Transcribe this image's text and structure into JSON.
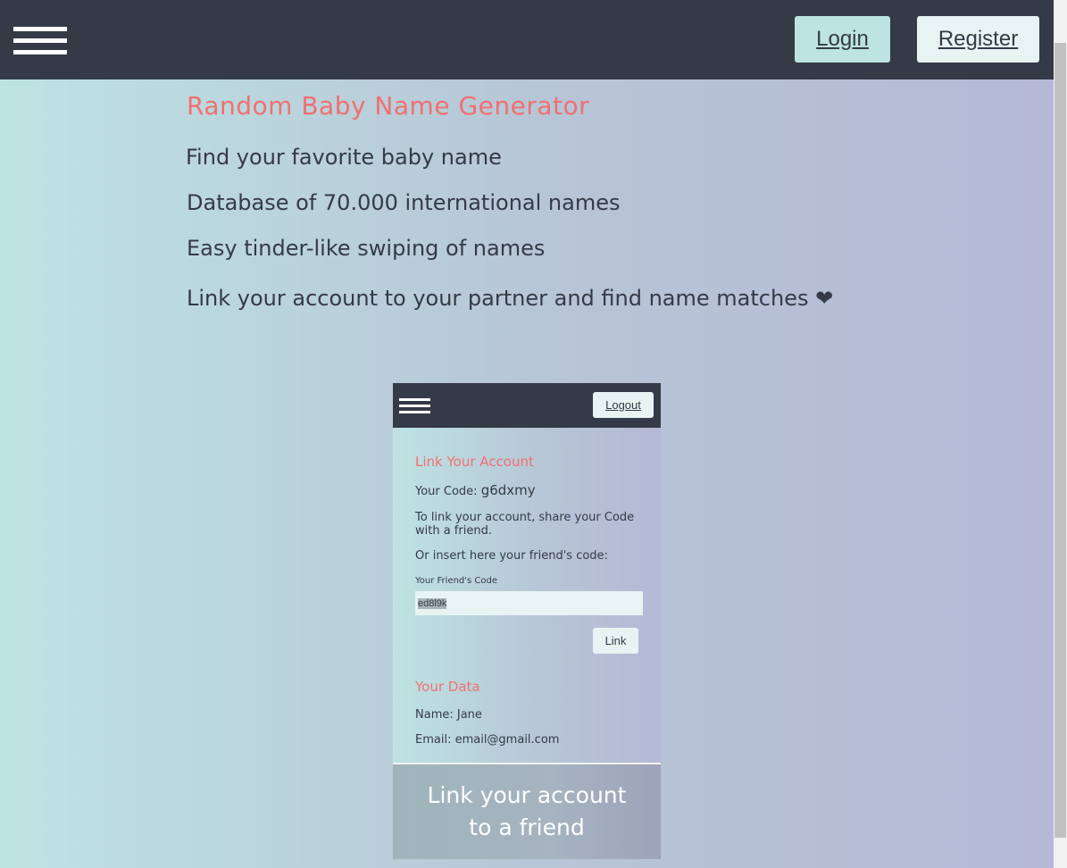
{
  "header": {
    "login_label": "Login",
    "register_label": "Register"
  },
  "main": {
    "title": "Random Baby Name Generator",
    "features": [
      "Find your favorite baby name",
      "Database of 70.000 international names",
      "Easy tinder-like swiping of names",
      "Link your account to your partner and find name matches"
    ],
    "heart": "❤"
  },
  "phone": {
    "logout_label": "Logout",
    "link_heading": "Link Your Account",
    "code_label": "Your Code: ",
    "code_value": "g6dxmy",
    "share_text": "To link your account, share your Code with a friend.",
    "insert_text": "Or insert here your friend's code:",
    "friend_code_label": "Your Friend's Code",
    "friend_code_value": "ed8l9k",
    "link_button": "Link",
    "data_heading": "Your Data",
    "name_line": "Name: Jane",
    "email_line": "Email: email@gmail.com",
    "caption": "Link your account to a friend"
  },
  "colors": {
    "nav_bg": "#353a47",
    "accent": "#f07070",
    "login_bg": "#bde3e3",
    "register_bg": "#e8f3f3"
  }
}
